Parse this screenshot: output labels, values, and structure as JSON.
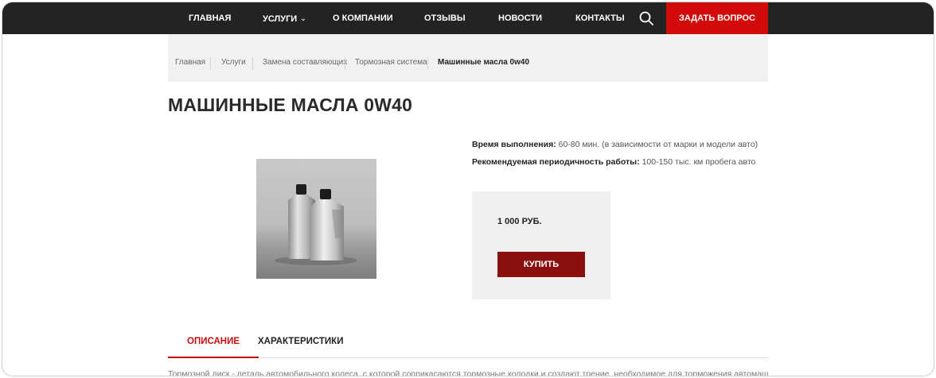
{
  "nav": {
    "items": [
      {
        "label": "Главная"
      },
      {
        "label": "Услуги",
        "has_dropdown": true
      },
      {
        "label": "О компании"
      },
      {
        "label": "Отзывы"
      },
      {
        "label": "Новости"
      },
      {
        "label": "Контакты"
      }
    ],
    "search_icon": "search-icon",
    "cta_label": "Задать вопрос",
    "bg_color": "#232323",
    "cta_color": "#d10a0a"
  },
  "breadcrumb": {
    "items": [
      {
        "label": "Главная"
      },
      {
        "label": "Услуги"
      },
      {
        "label": "Замена составляющих"
      },
      {
        "label": "Тормозная система"
      }
    ],
    "current": "Машинные масла 0w40"
  },
  "product": {
    "title": "Машинные масла 0W40",
    "image_alt": "oil-canisters-image",
    "time_label": "Время выполнения:",
    "time_value": " 60-80 мин. (в зависимости от марки и модели авто)",
    "period_label": "Рекомендуемая периодичность работы:",
    "period_value": " 100-150 тыс. км пробега авто",
    "price": "1 000 руб.",
    "buy_label": "Купить",
    "buy_color": "#8a0f0f"
  },
  "tabs": [
    {
      "label": "Описание",
      "active": true
    },
    {
      "label": "Характеристики",
      "active": false
    }
  ],
  "description": "Тормозной диск - деталь автомобильного колеса, с которой соприкасаются тормозные колодки и создают трение, необходимое для торможения автомашины"
}
